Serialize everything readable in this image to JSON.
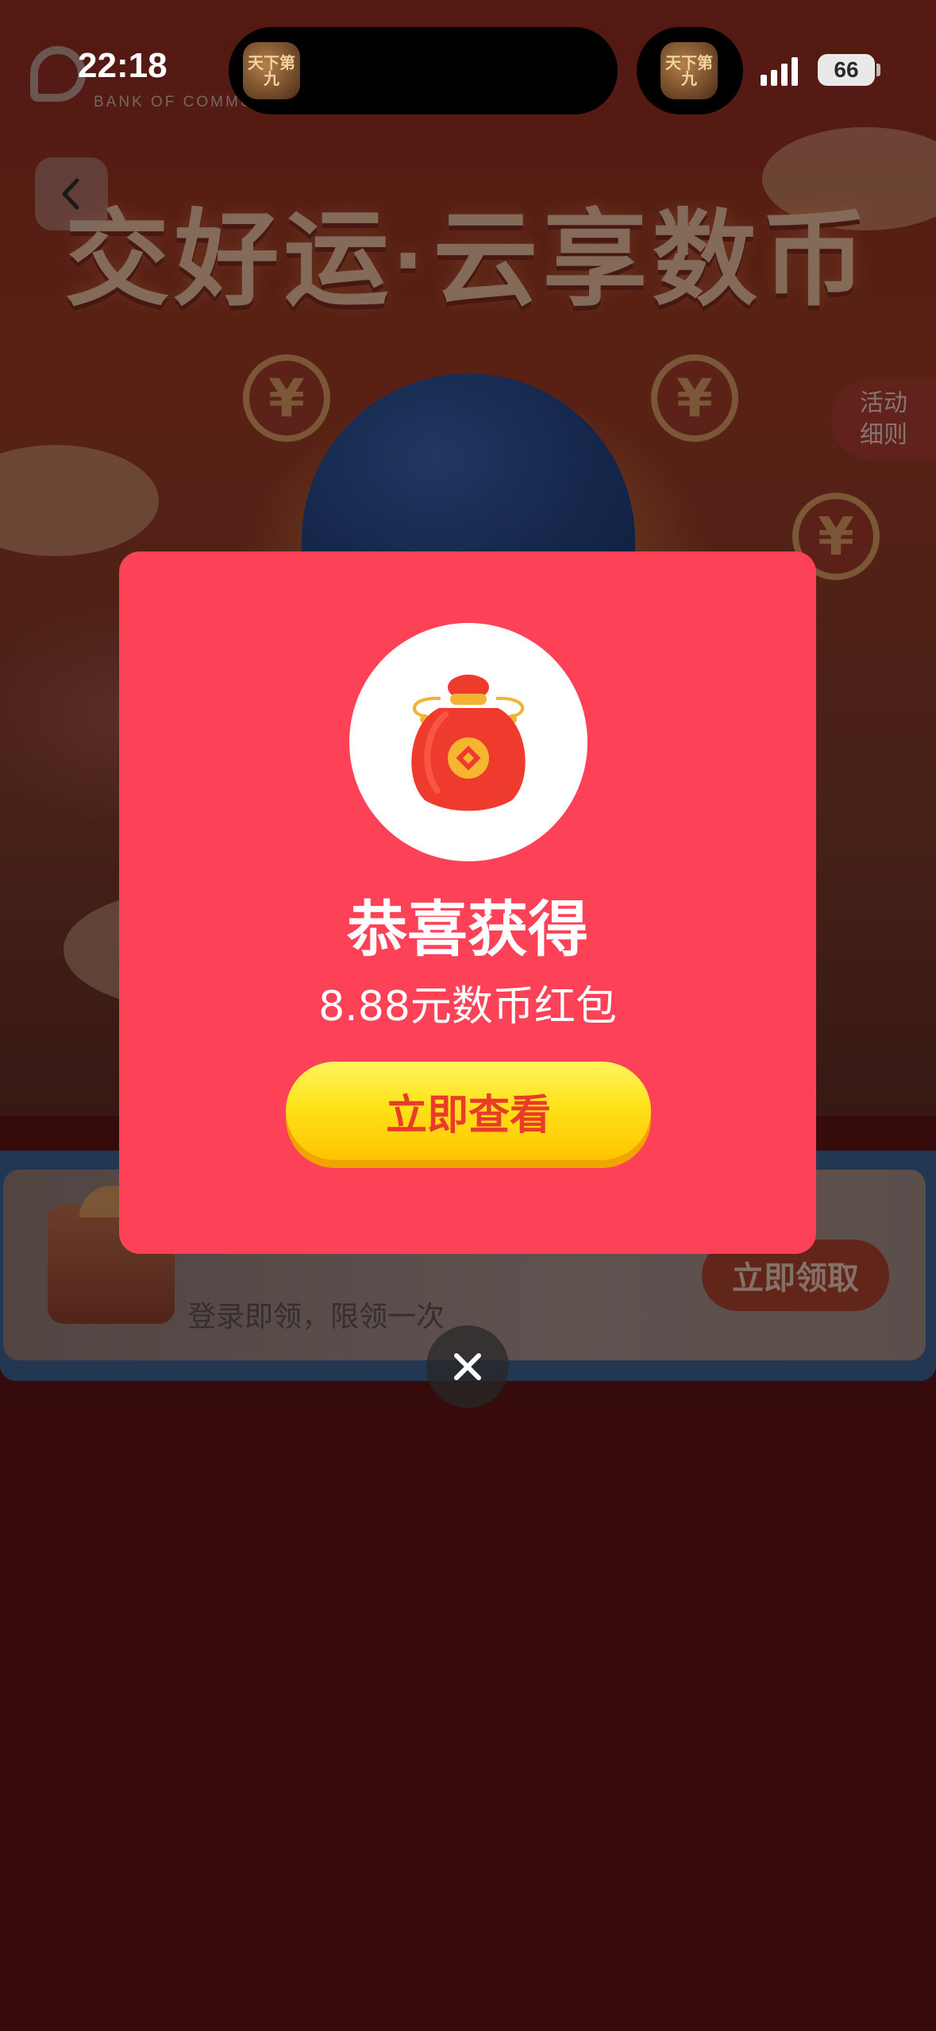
{
  "status_bar": {
    "time": "22:18",
    "battery": "66",
    "island_icon_text": "天下第九"
  },
  "background": {
    "bank_name": "BANK OF COMMU",
    "hero_title": "交好运·云享数币",
    "coin_symbol": "¥",
    "rules_tab": [
      "活动",
      "细则"
    ],
    "banner_subtitle": "登录即领，限领一次",
    "banner_claim_button": "立即领取"
  },
  "modal": {
    "title": "恭喜获得",
    "subtitle": "8.88元数币红包",
    "button_label": "立即查看",
    "prize_icon": "red-lucky-bag-icon",
    "close_icon": "close-icon"
  },
  "colors": {
    "modal_bg": "#fd4157",
    "button_yellow": "#ffe21a",
    "button_text": "#ea3a2a",
    "page_bg": "#5e1314"
  }
}
